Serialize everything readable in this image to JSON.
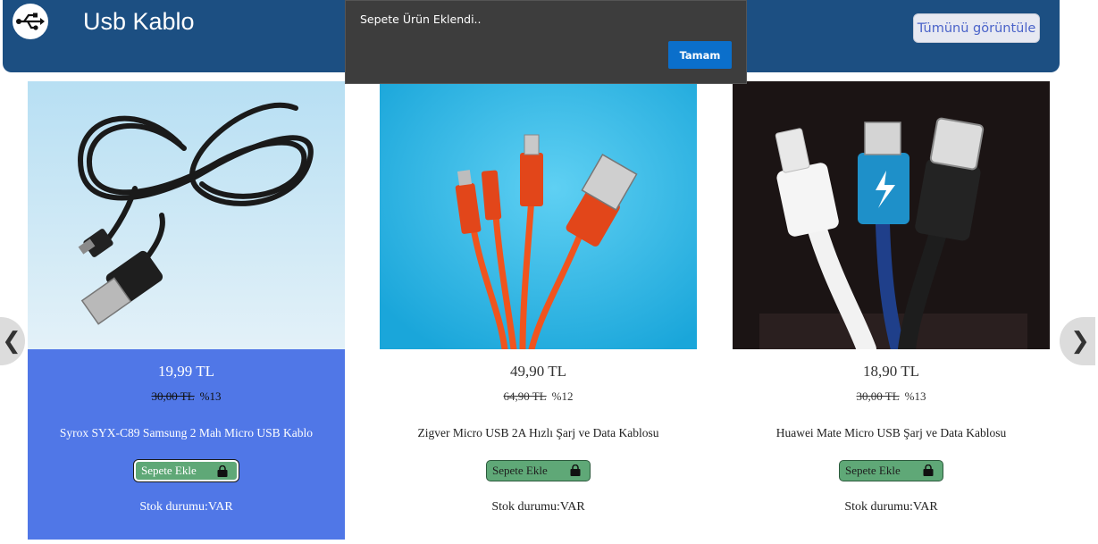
{
  "header": {
    "title": "Usb Kablo",
    "icon": "usb-icon",
    "view_all_label": "Tümünü görüntüle",
    "bg_color": "#1c4f82"
  },
  "toast": {
    "message": "Sepete Ürün Eklendi..",
    "ok_label": "Tamam",
    "button_color": "#0b6fcb"
  },
  "products": [
    {
      "price": "19,99 TL",
      "old_price": "30,00 TL",
      "discount": "%13",
      "name": "Syrox SYX-C89 Samsung 2 Mah Micro USB Kablo",
      "add_label": "Sepete Ekle",
      "stock": "Stok durumu:VAR",
      "image": "black-usb-cable-photo"
    },
    {
      "price": "49,90 TL",
      "old_price": "64,90 TL",
      "discount": "%12",
      "name": "Zigver Micro USB 2A Hızlı Şarj ve Data Kablosu",
      "add_label": "Sepete Ekle",
      "stock": "Stok durumu:VAR",
      "image": "orange-cables-on-blue-photo"
    },
    {
      "price": "18,90 TL",
      "old_price": "30,00 TL",
      "discount": "%13",
      "name": "Huawei Mate Micro USB Şarj ve Data Kablosu",
      "add_label": "Sepete Ekle",
      "stock": "Stok durumu:VAR",
      "image": "three-connectors-dark-photo"
    }
  ],
  "nav": {
    "prev_icon": "chevron-left-icon",
    "next_icon": "chevron-right-icon",
    "prev_glyph": "❮",
    "next_glyph": "❯"
  },
  "colors": {
    "active_card": "#5077e7",
    "add_button": "#5fa877"
  }
}
